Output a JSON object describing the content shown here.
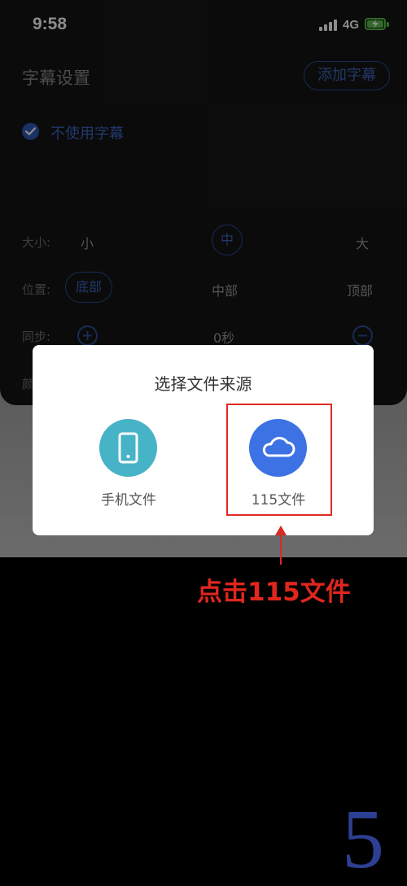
{
  "status_bar": {
    "time": "9:58",
    "network": "4G"
  },
  "panel": {
    "title": "字幕设置",
    "add_button": "添加字幕",
    "no_subtitle_label": "不使用字幕",
    "size": {
      "label": "大小:",
      "options": [
        "小",
        "中",
        "大"
      ],
      "selected": "中"
    },
    "position": {
      "label": "位置:",
      "options": [
        "底部",
        "中部",
        "顶部"
      ],
      "selected": "底部"
    },
    "sync": {
      "label": "同步:",
      "value": "0秒"
    },
    "color": {
      "label": "颜"
    }
  },
  "dialog": {
    "title": "选择文件来源",
    "options": [
      {
        "label": "手机文件",
        "icon": "phone-icon",
        "color": "#47b3c6"
      },
      {
        "label": "115文件",
        "icon": "cloud-icon",
        "color": "#3c72e4"
      }
    ]
  },
  "annotation": {
    "hint": "点击115文件",
    "step": "5"
  },
  "colors": {
    "accent": "#3d66c3",
    "highlight": "#e02a22"
  }
}
